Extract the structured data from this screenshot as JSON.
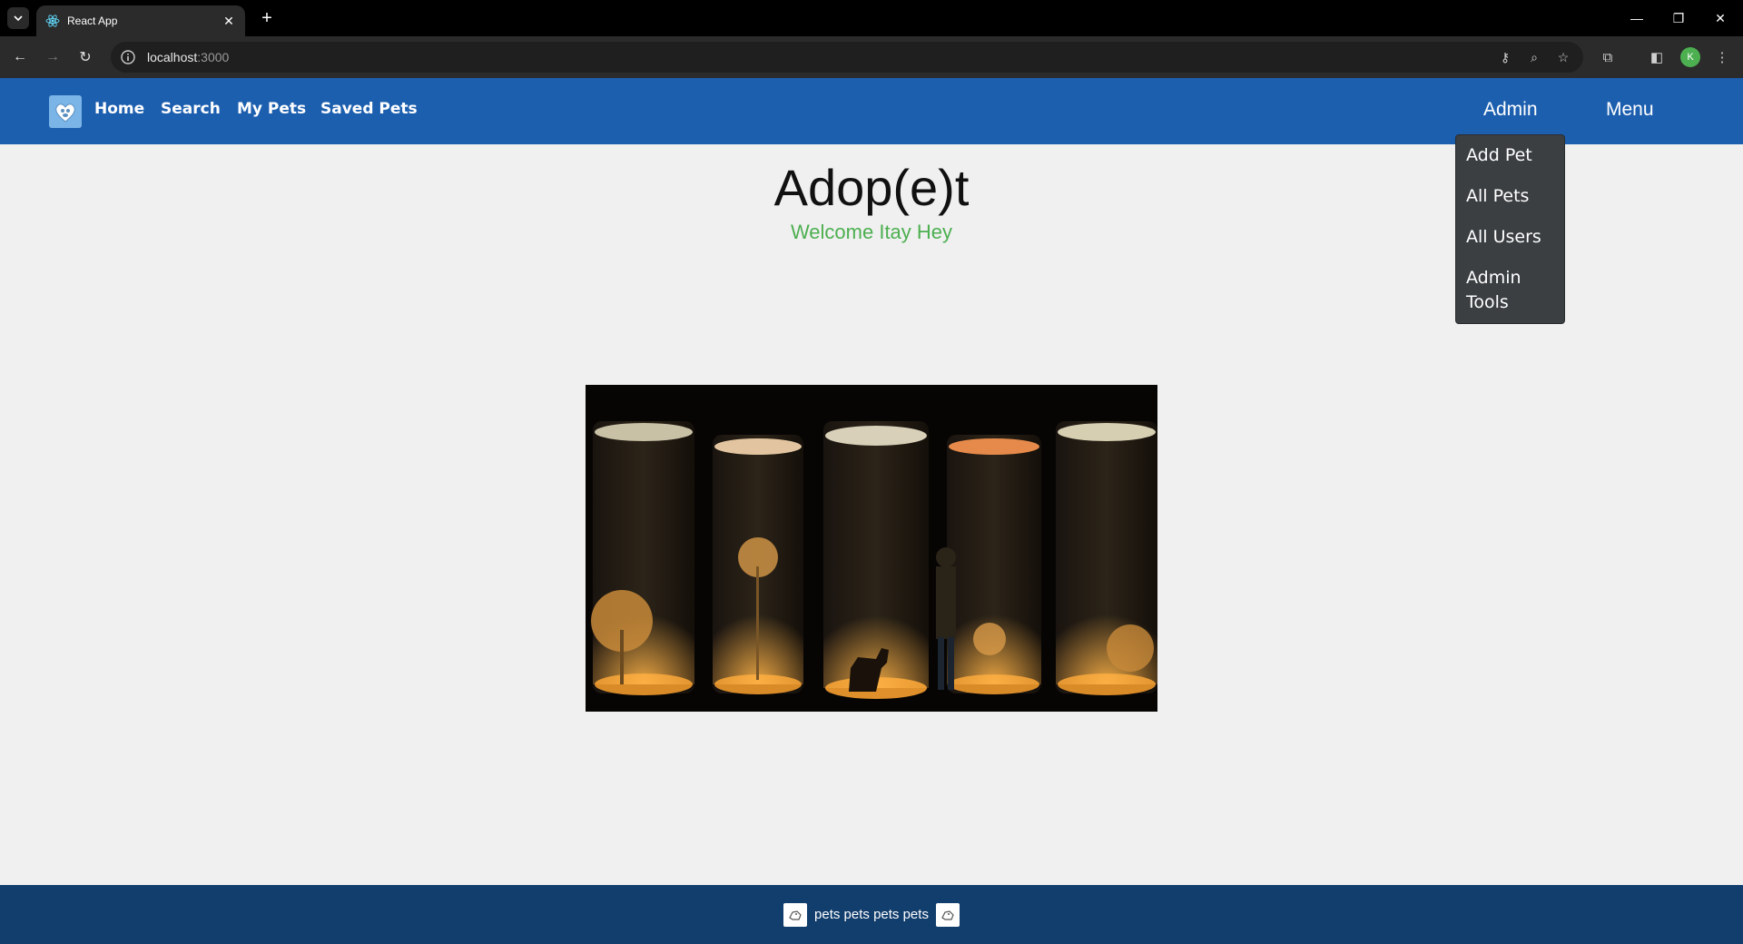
{
  "browser": {
    "tab_title": "React App",
    "url_host": "localhost",
    "url_port": ":3000",
    "profile_initial": "K"
  },
  "nav": {
    "links": [
      "Home",
      "Search",
      "My Pets",
      "Saved Pets"
    ],
    "admin_label": "Admin",
    "menu_label": "Menu"
  },
  "admin_dropdown": {
    "items": [
      "Add Pet",
      "All Pets",
      "All Users",
      "Admin Tools"
    ]
  },
  "main": {
    "title": "Adop(e)t",
    "welcome": "Welcome Itay Hey"
  },
  "footer": {
    "text": "pets pets pets pets"
  },
  "colors": {
    "navbar": "#1c5faf",
    "footer": "#123e6d",
    "welcome": "#4caf50",
    "dropdown_bg": "#3b3f42"
  }
}
